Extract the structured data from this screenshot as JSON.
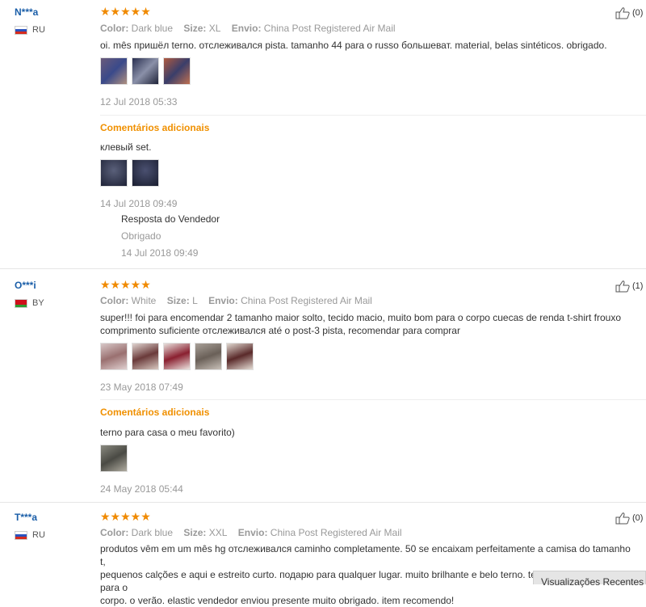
{
  "reviews": [
    {
      "user": "N***a",
      "country": "RU",
      "stars": "★★★★★",
      "helpful": "(0)",
      "color_label": "Color:",
      "color": "Dark blue",
      "size_label": "Size:",
      "size": "XL",
      "ship_label": "Envio:",
      "ship": "China Post Registered Air Mail",
      "text": "oi. mês пришёл terno. отслеживался pista. tamanho 44 para o russo большеват. material, belas sintéticos. obrigado.",
      "date": "12 Jul 2018 05:33",
      "additional_title": "Comentários adicionais",
      "additional_text": "клевый set.",
      "additional_date": "14 Jul 2018 09:49",
      "response_title": "Resposta do Vendedor",
      "response_text": "Obrigado",
      "response_date": "14 Jul 2018 09:49"
    },
    {
      "user": "O***i",
      "country": "BY",
      "stars": "★★★★★",
      "helpful": "(1)",
      "color_label": "Color:",
      "color": "White",
      "size_label": "Size:",
      "size": "L",
      "ship_label": "Envio:",
      "ship": "China Post Registered Air Mail",
      "text_line1": "super!!! foi para encomendar 2 tamanho maior solto, tecido macio, muito bom para o corpo cuecas de renda t-shirt frouxo",
      "text_line2": "comprimento suficiente отслеживался até o post-3 pista, recomendar para comprar",
      "date": "23 May 2018 07:49",
      "additional_title": "Comentários adicionais",
      "additional_text": "terno para casa o meu favorito)",
      "additional_date": "24 May 2018 05:44"
    },
    {
      "user": "T***a",
      "country": "RU",
      "stars": "★★★★★",
      "helpful": "(0)",
      "color_label": "Color:",
      "color": "Dark blue",
      "size_label": "Size:",
      "size": "XXL",
      "ship_label": "Envio:",
      "ship": "China Post Registered Air Mail",
      "text_line1": "produtos vêm em um mês hg отслеживался caminho completamente. 50 se encaixam perfeitamente a camisa do tamanho t,",
      "text_line2": "pequenos calções e aqui e estreito curto. подарю para qualquer lugar. muito brilhante e belo terno. tecido fino, luz, bom para o",
      "text_line3": "corpo. o verão. elastic vendedor enviou presente muito obrigado. item recomendo!"
    }
  ],
  "recent_tab": "Visualizações Recentes",
  "colors": {
    "accent_orange": "#f09000",
    "user_blue": "#1a5ea8",
    "star": "#f08a00"
  }
}
